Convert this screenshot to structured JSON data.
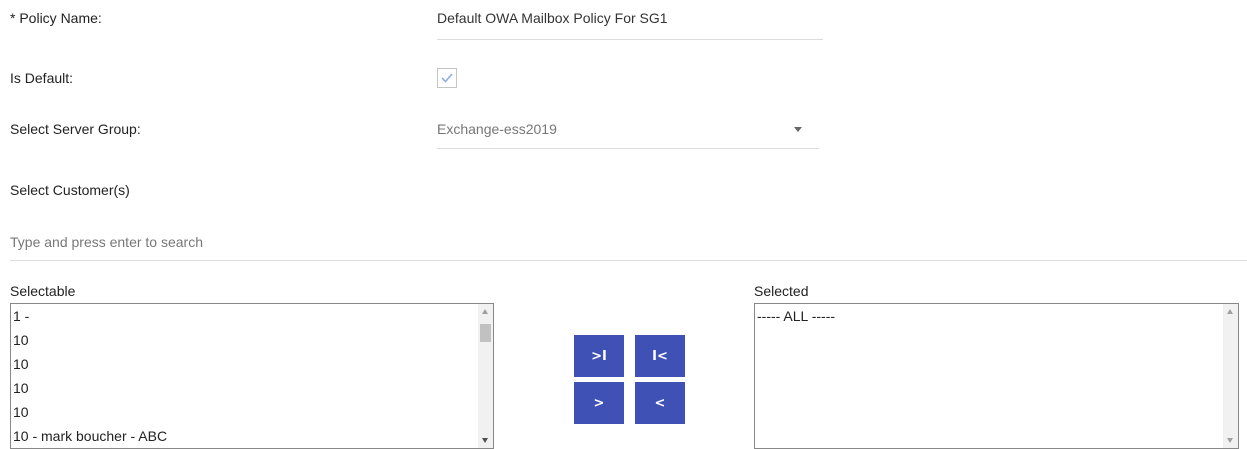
{
  "form": {
    "policy_name_label": "* Policy Name:",
    "policy_name_value": "Default OWA Mailbox Policy For SG1",
    "is_default_label": "Is Default:",
    "is_default_checked": true,
    "server_group_label": "Select Server Group:",
    "server_group_value": "Exchange-ess2019",
    "customers_label": "Select Customer(s)",
    "search_placeholder": "Type and press enter to search"
  },
  "selectable": {
    "label": "Selectable",
    "items": [
      "1 - ",
      "10",
      "10",
      "10",
      "10",
      "10 - mark boucher - ABC"
    ]
  },
  "selected": {
    "label": "Selected",
    "items": [
      "----- ALL -----"
    ]
  },
  "buttons": {
    "move_all_right": ">I",
    "move_all_left": "I<",
    "move_right": ">",
    "move_left": "<"
  },
  "colors": {
    "accent": "#3f51b5",
    "checkbox_check": "#8ab0e6"
  }
}
